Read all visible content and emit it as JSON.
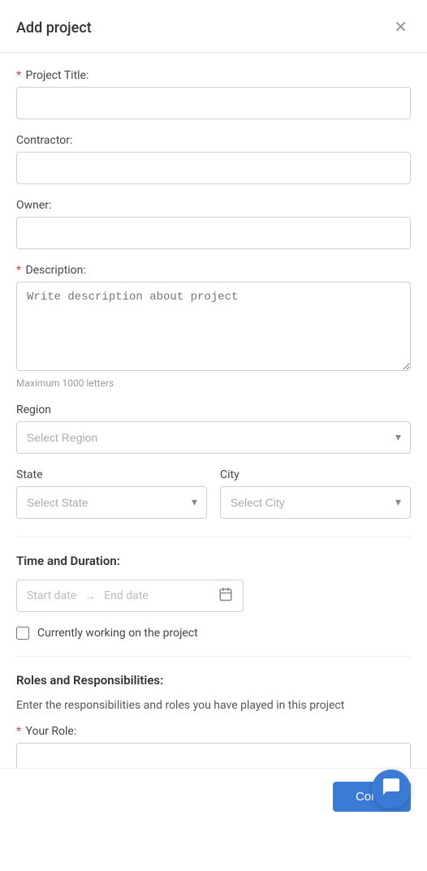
{
  "modal": {
    "title": "Add project",
    "close_label": "×"
  },
  "form": {
    "project_title_label": "Project Title:",
    "project_title_required": true,
    "project_title_placeholder": "",
    "contractor_label": "Contractor:",
    "contractor_placeholder": "",
    "owner_label": "Owner:",
    "owner_placeholder": "",
    "description_label": "Description:",
    "description_required": true,
    "description_placeholder": "Write description about project",
    "description_char_limit": "Maximum 1000 letters",
    "region_label": "Region",
    "region_placeholder": "Select Region",
    "state_label": "State",
    "state_placeholder": "Select State",
    "city_label": "City",
    "city_placeholder": "Select City",
    "time_duration_label": "Time and Duration:",
    "start_date_placeholder": "Start date",
    "end_date_placeholder": "End date",
    "currently_working_label": "Currently working on the project",
    "roles_section_title": "Roles and Responsibilities:",
    "roles_description": "Enter the responsibilities and roles you have played in this project",
    "your_role_label": "Your Role:",
    "your_role_required": true,
    "your_role_placeholder": "",
    "continue_btn_label": "Con..."
  },
  "icons": {
    "chevron_down": "▾",
    "close": "✕",
    "arrow_right": "→",
    "calendar": "📅",
    "chat": "💬"
  }
}
